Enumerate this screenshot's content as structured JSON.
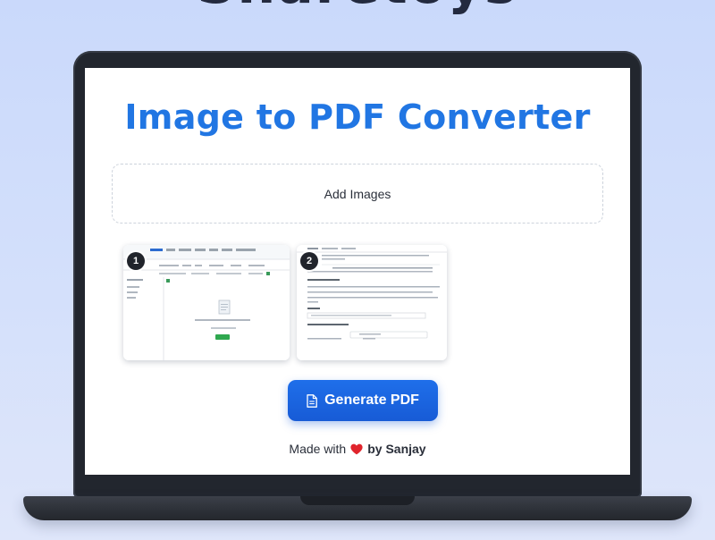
{
  "background": {
    "heading_text": "Sharetoys"
  },
  "app": {
    "title": "Image to PDF Converter",
    "dropzone_label": "Add Images",
    "thumbnails": [
      {
        "badge": "1",
        "description": "spreadsheet-style app screenshot"
      },
      {
        "badge": "2",
        "description": "text document screenshot"
      }
    ],
    "generate_button_label": "Generate PDF",
    "footer": {
      "made_with": "Made with",
      "by": "by Sanjay"
    }
  },
  "colors": {
    "title": "#2176e3",
    "button": "#1f6fea",
    "heart": "#e0242c",
    "laptop": "#22262e"
  },
  "icons": {
    "button_icon": "document-icon",
    "footer_icon": "heart-icon"
  }
}
